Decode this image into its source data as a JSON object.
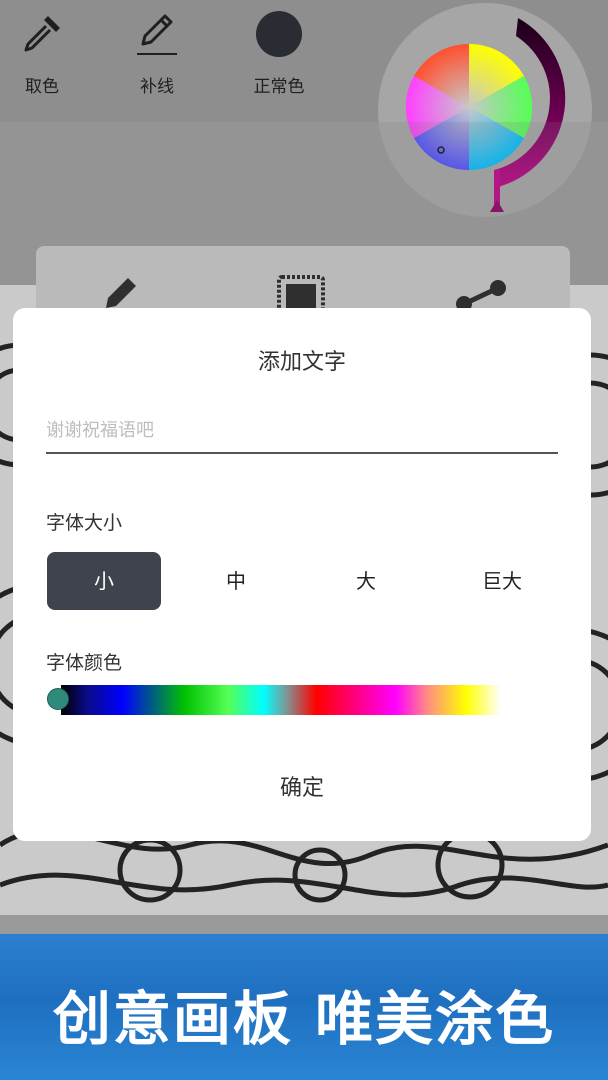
{
  "toolbar": {
    "eyedropper_label": "取色",
    "patch_line_label": "补线",
    "normal_color_label": "正常色"
  },
  "dialog": {
    "title": "添加文字",
    "input_placeholder": "谢谢祝福语吧",
    "input_value": "",
    "font_size_label": "字体大小",
    "size_options": [
      "小",
      "中",
      "大",
      "巨大"
    ],
    "selected_size": "小",
    "font_color_label": "字体颜色",
    "confirm_label": "确定"
  },
  "banner": {
    "text": "创意画板 唯美涂色"
  },
  "colors": {
    "selected_size_bg": "#3f434b",
    "color_thumb": "#2f8a7a",
    "banner_blue": "#2176c7",
    "wheel_ring": "#b0007f"
  },
  "icons": {
    "eyedropper": "eyedropper-icon",
    "pencil": "pencil-icon",
    "normal_color": "filled-circle-icon",
    "frame": "frame-icon",
    "share": "share-icon"
  }
}
